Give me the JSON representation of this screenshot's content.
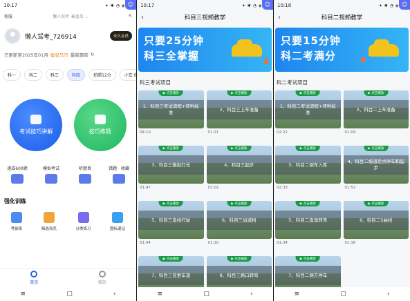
{
  "panel1": {
    "status": {
      "time": "10:17",
      "right": "✦ ✱ ◔ ◈ 75"
    },
    "top": {
      "left": "客服",
      "brand": "懒人驾考",
      "city": "秦皇岛 ⌄"
    },
    "user": {
      "name": "懒人驾考_726914",
      "vip": "永久会员"
    },
    "update": {
      "prefix": "已更新至2025年01月",
      "city": "秦皇岛市",
      "suffix": "最新题库"
    },
    "tabs": [
      "科一",
      "科二",
      "科三",
      "科四",
      "拍照12分",
      "小车 仿真模考"
    ],
    "active_tab": 3,
    "big_buttons": [
      {
        "label": "考试技巧讲解",
        "color": "blue"
      },
      {
        "label": "技巧练题",
        "color": "green"
      }
    ],
    "grid": [
      "速成600题",
      "模拟考试",
      "听题目",
      "错题 · 收藏"
    ],
    "section": "强化训练",
    "grid2": [
      {
        "label": "考前练",
        "color": "#4b8cf0"
      },
      {
        "label": "精选攻克",
        "color": "#f0a53a"
      },
      {
        "label": "分类练习",
        "color": "#7b6bf0"
      },
      {
        "label": "图标速记",
        "color": "#3aa0f0"
      }
    ],
    "bottom_tabs": [
      {
        "label": "首页",
        "active": true
      },
      {
        "label": "我的",
        "active": false
      }
    ]
  },
  "panel2": {
    "status": {
      "time": "10:17",
      "right": "✦ ✱ ◔ ◈ 75"
    },
    "title": "科目三视频教学",
    "banner": {
      "line1": "只要25分钟",
      "line2": "科三全掌握"
    },
    "section": "科三考试项目",
    "play_label": "▶ 点击播放",
    "videos": [
      {
        "caption": "1、科目三考试流程+评判标准",
        "duration": "04:10"
      },
      {
        "caption": "2、科目三上车准备",
        "duration": "01:21"
      },
      {
        "caption": "3、科目三模拟灯光",
        "duration": "01:47"
      },
      {
        "caption": "4、科目三起步",
        "duration": "02:02"
      },
      {
        "caption": "5、科目三直线行驶",
        "duration": "01:44"
      },
      {
        "caption": "6、科目三加减档",
        "duration": "01:30"
      },
      {
        "caption": "7、科目三变更车道",
        "duration": ""
      },
      {
        "caption": "8、科目三路口转弯",
        "duration": ""
      }
    ]
  },
  "panel3": {
    "status": {
      "time": "10:18",
      "right": "✦ ✱ ◔ ◈ 75"
    },
    "title": "科目二视频教学",
    "banner": {
      "line1": "只要15分钟",
      "line2": "科二考满分"
    },
    "section": "科二考试项目",
    "play_label": "▶ 点击播放",
    "videos": [
      {
        "caption": "1、科目二考试流程+评判标准",
        "duration": "02:22"
      },
      {
        "caption": "2、科目二上车准备",
        "duration": "01:09"
      },
      {
        "caption": "3、科目二倒车入库",
        "duration": "02:33"
      },
      {
        "caption": "4、科目二坡道定点停车和起步",
        "duration": "01:52"
      },
      {
        "caption": "5、科目二直角转弯",
        "duration": "01:34"
      },
      {
        "caption": "6、科目二S曲线",
        "duration": "01:36"
      },
      {
        "caption": "7、科目二侧方停车",
        "duration": ""
      }
    ]
  },
  "nav": {
    "menu": "≡",
    "home": "▢",
    "back": "‹"
  }
}
